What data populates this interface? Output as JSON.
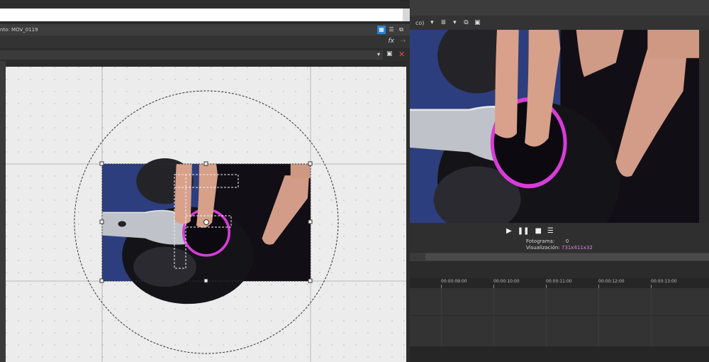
{
  "pan_crop": {
    "media_label": "nto: MOV_0119",
    "fx_label": "fx",
    "toolbar_icons": [
      "grid-icon",
      "list-icon",
      "copy-icon"
    ],
    "delete_symbol": "✕",
    "save_symbol": "💾"
  },
  "main": {
    "toolbar_text": "co)",
    "transport": {
      "play": "▶",
      "pause": "❚❚",
      "stop": "■",
      "menu": "☰",
      "frame_label": "Fotograma:",
      "frame_value": "0",
      "display_label": "Visualización:",
      "display_value": "731x411x32"
    },
    "ruler_ticks": [
      "00:00:09:00",
      "00:00:10:00",
      "00:00:11:00",
      "00:00:12:00",
      "00:00:13:00"
    ]
  },
  "colors": {
    "accent_blue": "#2f7fcf",
    "info_pink": "#d68ad6",
    "ring_magenta": "#d83cd8",
    "workspace_bg": "#ececec"
  }
}
